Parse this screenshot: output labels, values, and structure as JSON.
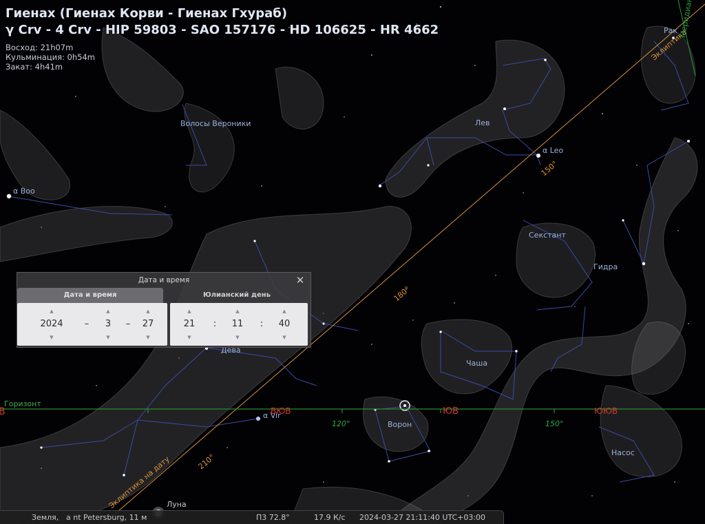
{
  "object": {
    "title_line1": "Гиенах (Гиенах Корви - Гиенах Гхураб)",
    "title_line2": "γ Crv - 4 Crv - HIP 59803 - SAO 157176 - HD 106625 - HR 4662",
    "rise": "Восход: 21h07m",
    "transit": "Кульминация: 0h54m",
    "set": "Закат: 4h41m"
  },
  "sky_labels": {
    "coma": "Волосы Вероники",
    "leo": "Лев",
    "alpha_leo": "α Leo",
    "alpha_boo": "α Boo",
    "sextans": "Секстант",
    "hydra": "Гидра",
    "virgo": "Дева",
    "crater": "Чаша",
    "corvus": "Ворон",
    "antlia": "Насос",
    "cancer": "Рак",
    "moon": "Луна",
    "alpha_vir": "α Vir",
    "horizon": "Горизонт",
    "ecliptic_date": "Эклиптика на дату",
    "ecliptic": "Эклиптика",
    "meridian": "Меридиан",
    "dir_v": "В",
    "dir_vyuv": "ВЮВ",
    "dir_yuv": "ЮВ",
    "dir_yuyuv": "ЮЮВ",
    "az_120": "120°",
    "az_150": "150°",
    "ecl_150": "150°",
    "ecl_180": "180°",
    "ecl_210": "210°"
  },
  "dialog": {
    "title": "Дата и время",
    "close_symbol": "✕",
    "tab_datetime": "Дата и время",
    "tab_julian": "Юлианский день",
    "year": "2024",
    "month": "3",
    "day": "27",
    "hour": "21",
    "minute": "11",
    "second": "40",
    "date_sep": "–",
    "time_sep": ":",
    "arrow_up": "▲",
    "arrow_down": "▼"
  },
  "status": {
    "planet": "Земля,",
    "location": "a nt Petersburg, 11 м",
    "fov": "П3 72.8°",
    "fps": "17.9 К/с",
    "datetime": "2024-03-27 21:11:40 UTC+03:00"
  },
  "colors": {
    "background": "#000000",
    "horizon": "#2f8a2f",
    "ecliptic": "#d9913a",
    "constellation_lines": "#3d4aa8",
    "constellation_labels": "#9cb3db",
    "cardinal": "#d33a2a",
    "azimuth": "#2aa84a",
    "meridian": "#2a9a3a"
  },
  "icons": [
    "close-icon",
    "arrow-up-icon",
    "arrow-down-icon"
  ]
}
